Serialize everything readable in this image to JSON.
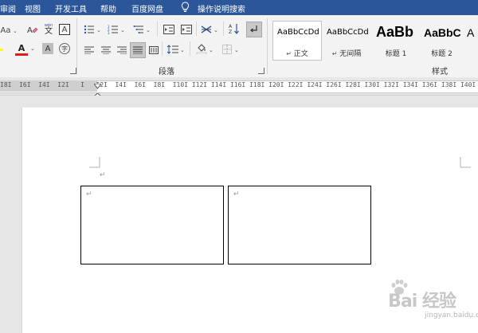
{
  "menubar": {
    "items": [
      "审阅",
      "视图",
      "开发工具",
      "帮助",
      "百度网盘"
    ],
    "tell_me": "操作说明搜索"
  },
  "ribbon": {
    "font_group": {
      "font_size_prefix": "Aa",
      "clear_format_icon": "clear-format-icon",
      "phonetic_label_top": "wén",
      "phonetic_label_char": "文",
      "char_border_label": "A",
      "font_color_label": "A",
      "char_shading_label": "A",
      "enclose_char_label": "字",
      "font_color": "#e41b17"
    },
    "paragraph_group": {
      "label": "段落"
    },
    "styles_group": {
      "label": "样式",
      "tiles": [
        {
          "sample": "AaBbCcDd",
          "name": "正文",
          "marker": "↵",
          "selected": true
        },
        {
          "sample": "AaBbCcDd",
          "name": "无间隔",
          "marker": "↵",
          "selected": false
        },
        {
          "sample": "AaBb",
          "name": "标题 1",
          "selected": false
        },
        {
          "sample": "AaBbC",
          "name": "标题 2",
          "selected": false
        },
        {
          "sample": "A",
          "name": "",
          "selected": false
        }
      ]
    }
  },
  "ruler": {
    "text": "I8I  I6I  I4I  I2I   I   I2I  I4I  I6I  I8I  I10I I12I I14I I16I I18I I20I I22I I24I I26I I28I I30I I32I I34I I36I I38I I40I I42I I44I"
  },
  "document": {
    "paragraph_mark": "↵"
  },
  "watermark": {
    "logo": "Bai 经验",
    "url": "jingyan.baidu.com"
  },
  "colors": {
    "menubar_bg": "#2b579a",
    "font_color_bar": "#e41b17",
    "highlight_bar": "#ffff00"
  }
}
